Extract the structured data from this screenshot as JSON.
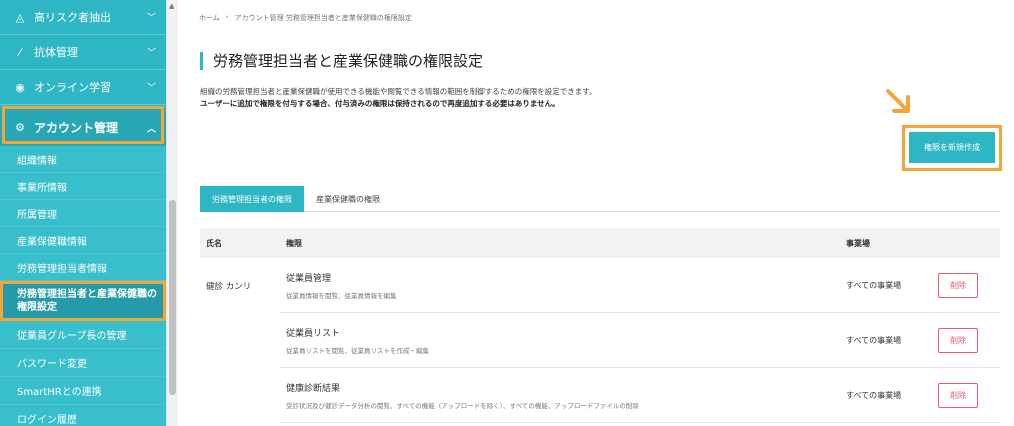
{
  "sidebar": {
    "top_items": [
      {
        "label": "高リスク者抽出",
        "icon": "chart-icon"
      },
      {
        "label": "抗体管理",
        "icon": "syringe-icon"
      },
      {
        "label": "オンライン学習",
        "icon": "eye-icon"
      }
    ],
    "account": {
      "label": "アカウント管理",
      "icon": "gear-icon"
    },
    "sub_items": [
      {
        "label": "組織情報"
      },
      {
        "label": "事業所情報"
      },
      {
        "label": "所属管理"
      },
      {
        "label": "産業保健職情報"
      },
      {
        "label": "労務管理担当者情報"
      },
      {
        "label": "労務管理担当者と産業保健職の権限設定"
      },
      {
        "label": "従業員グループ長の管理"
      },
      {
        "label": "パスワード変更"
      },
      {
        "label": "SmartHRとの連携"
      },
      {
        "label": "ログイン履歴"
      }
    ]
  },
  "breadcrumb": {
    "home": "ホーム",
    "separator": "›",
    "current": "アカウント管理 労務管理担当者と産業保健職の権限設定"
  },
  "page": {
    "title": "労務管理担当者と産業保健職の権限設定",
    "description1": "組織の労務管理担当者と産業保健職が使用できる機能や閲覧できる情報の範囲を制御するための権限を設定できます。",
    "description2": "ユーザーに追加で権限を付与する場合、付与済みの権限は保持されるので再度追加する必要はありません。",
    "create_button": "権限を新規作成"
  },
  "tabs": [
    {
      "label": "労務管理担当者の権限",
      "active": true
    },
    {
      "label": "産業保健職の権限",
      "active": false
    }
  ],
  "table": {
    "headers": {
      "name": "氏名",
      "permission": "権限",
      "site": "事業場"
    },
    "user": "健診 カンリ",
    "rows": [
      {
        "title": "従業員管理",
        "desc": "従業員情報を閲覧、従業員情報を編集",
        "site": "すべての事業場",
        "action": "削除"
      },
      {
        "title": "従業員リスト",
        "desc": "従業員リストを閲覧、従業員リストを作成・編集",
        "site": "すべての事業場",
        "action": "削除"
      },
      {
        "title": "健康診断結果",
        "desc": "受診状況及び健診データ分析の閲覧、すべての機能（アップロードを除く）、すべての機能、アップロードファイルの削除",
        "site": "すべての事業場",
        "action": "削除"
      }
    ]
  },
  "colors": {
    "accent": "#2fb6c4",
    "highlight": "#f4a53a",
    "danger": "#e45b6a"
  }
}
